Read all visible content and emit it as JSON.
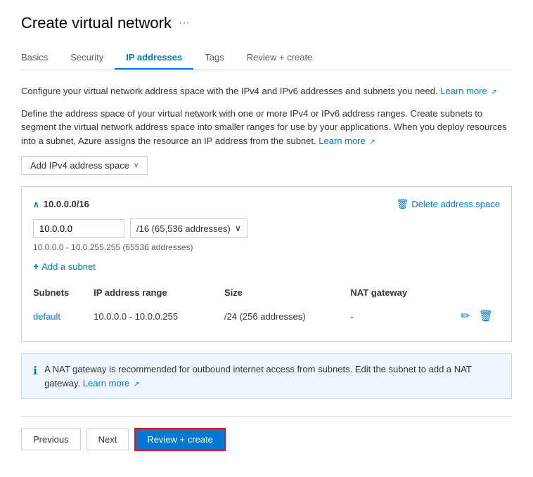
{
  "page": {
    "title": "Create virtual network",
    "ellipsis_label": "···"
  },
  "tabs": {
    "items": [
      {
        "id": "basics",
        "label": "Basics",
        "active": false
      },
      {
        "id": "security",
        "label": "Security",
        "active": false
      },
      {
        "id": "ip-addresses",
        "label": "IP addresses",
        "active": true
      },
      {
        "id": "tags",
        "label": "Tags",
        "active": false
      },
      {
        "id": "review-create",
        "label": "Review + create",
        "active": false
      }
    ]
  },
  "description1": "Configure your virtual network address space with the IPv4 and IPv6 addresses and subnets you need.",
  "description1_link": "Learn more",
  "description2": "Define the address space of your virtual network with one or more IPv4 or IPv6 address ranges. Create subnets to segment the virtual network address space into smaller ranges for use by your applications. When you deploy resources into a subnet, Azure assigns the resource an IP address from the subnet.",
  "description2_link": "Learn more",
  "add_ipv4_btn": "Add IPv4 address space",
  "address_space": {
    "title": "10.0.0.0/16",
    "ip_value": "10.0.0.0",
    "cidr_value": "/16 (65,536 addresses)",
    "range_hint": "10.0.0.0 - 10.0.255.255 (65536 addresses)",
    "delete_label": "Delete address space",
    "add_subnet_label": "Add a subnet"
  },
  "subnets_table": {
    "headers": [
      "Subnets",
      "IP address range",
      "Size",
      "NAT gateway"
    ],
    "rows": [
      {
        "name": "default",
        "ip_range": "10.0.0.0 - 10.0.0.255",
        "size": "/24 (256 addresses)",
        "nat_gateway": "-"
      }
    ]
  },
  "info_box": {
    "text": "A NAT gateway is recommended for outbound internet access from subnets. Edit the subnet to add a NAT gateway.",
    "link": "Learn more"
  },
  "buttons": {
    "previous": "Previous",
    "next": "Next",
    "review_create": "Review + create"
  },
  "icons": {
    "ellipsis": "···",
    "external_link": "↗",
    "chevron_down": "∨",
    "info": "ℹ",
    "delete": "🗑",
    "edit": "✏",
    "collapse": "∧",
    "plus": "+"
  }
}
